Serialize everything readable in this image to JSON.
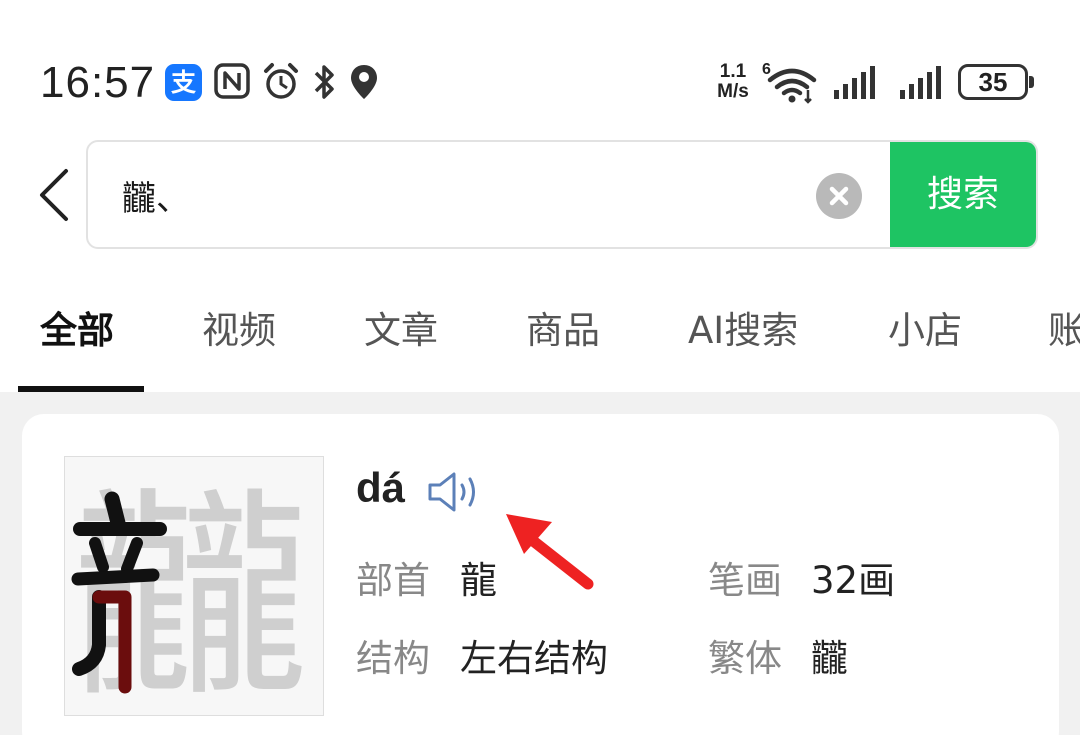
{
  "status_bar": {
    "time": "16:57",
    "alipay_glyph": "支",
    "network_speed_value": "1.1",
    "network_speed_unit": "M/s",
    "wifi_badge": "6",
    "battery_level": "35",
    "icons": [
      "alipay-icon",
      "nfc-icon",
      "alarm-icon",
      "bluetooth-icon",
      "location-icon",
      "wifi-icon",
      "signal-icon",
      "signal-icon",
      "battery-icon"
    ]
  },
  "search": {
    "query": "龖、",
    "button_label": "搜索"
  },
  "tabs": [
    {
      "label": "全部",
      "active": true
    },
    {
      "label": "视频",
      "active": false
    },
    {
      "label": "文章",
      "active": false
    },
    {
      "label": "商品",
      "active": false
    },
    {
      "label": "AI搜索",
      "active": false
    },
    {
      "label": "小店",
      "active": false
    },
    {
      "label": "账",
      "active": false
    }
  ],
  "result": {
    "character": "龖",
    "pinyin": "dá",
    "radical_label": "部首",
    "radical_value": "龍",
    "strokes_label": "笔画",
    "strokes_value": "32画",
    "structure_label": "结构",
    "structure_value": "左右结构",
    "traditional_label": "繁体",
    "traditional_value": "龖"
  },
  "colors": {
    "accent_green": "#1ec463",
    "annotation_arrow": "#ee2222",
    "tab_active": "#111111"
  }
}
